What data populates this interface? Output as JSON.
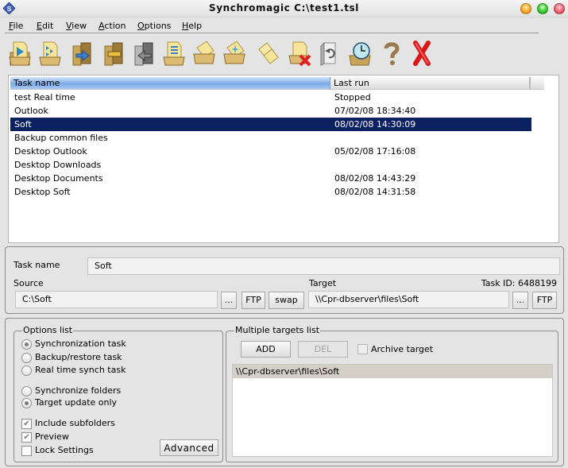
{
  "window": {
    "title": "Synchromagic C:\\test1.tsl",
    "app_icon": "synchromagic-logo-icon",
    "controls": [
      "minimize",
      "maximize",
      "close"
    ]
  },
  "menu": [
    {
      "label": "File",
      "accel": "F"
    },
    {
      "label": "Edit",
      "accel": "E"
    },
    {
      "label": "View",
      "accel": "V"
    },
    {
      "label": "Action",
      "accel": "A"
    },
    {
      "label": "Options",
      "accel": "O"
    },
    {
      "label": "Help",
      "accel": "H"
    }
  ],
  "toolbar": [
    {
      "icon": "folder-run-icon"
    },
    {
      "icon": "folder-run-all-icon"
    },
    {
      "icon": "folder-sync-icon"
    },
    {
      "icon": "folder-compare-icon"
    },
    {
      "icon": "folder-restore-icon"
    },
    {
      "icon": "folder-log-icon"
    },
    {
      "icon": "new-task-icon"
    },
    {
      "icon": "new-task-wizard-icon"
    },
    {
      "icon": "duplicate-task-icon"
    },
    {
      "icon": "delete-task-icon"
    },
    {
      "icon": "undo-icon"
    },
    {
      "icon": "schedule-icon"
    },
    {
      "icon": "help-icon"
    },
    {
      "icon": "exit-icon"
    }
  ],
  "tasks": {
    "columns": [
      "Task name",
      "Last run"
    ],
    "rows": [
      {
        "name": "test Real time",
        "last_run": "Stopped"
      },
      {
        "name": "Outlook",
        "last_run": "07/02/08 18:34:40"
      },
      {
        "name": "Soft",
        "last_run": "08/02/08 14:30:09",
        "selected": true
      },
      {
        "name": "Backup common files",
        "last_run": ""
      },
      {
        "name": "Desktop Outlook",
        "last_run": "05/02/08 17:16:08"
      },
      {
        "name": "Desktop Downloads",
        "last_run": ""
      },
      {
        "name": "Desktop Documents",
        "last_run": "08/02/08 14:43:29"
      },
      {
        "name": "Desktop Soft",
        "last_run": "08/02/08 14:31:58"
      }
    ]
  },
  "details": {
    "task_name_label": "Task name",
    "task_name_value": "Soft",
    "source_label": "Source",
    "source_value": "C:\\Soft",
    "target_label": "Target",
    "target_value": "\\\\Cpr-dbserver\\files\\Soft",
    "task_id": "Task ID: 6488199",
    "browse_label": "...",
    "ftp_label": "FTP",
    "swap_label": "swap"
  },
  "options": {
    "legend": "Options list",
    "task_types": [
      {
        "label": "Synchronization task",
        "checked": true
      },
      {
        "label": "Backup/restore task",
        "checked": false
      },
      {
        "label": "Real time synch task",
        "checked": false
      }
    ],
    "sync_modes": [
      {
        "label": "Synchronize folders",
        "checked": false
      },
      {
        "label": "Target update only",
        "checked": true
      }
    ],
    "checkboxes": [
      {
        "label": "Include subfolders",
        "checked": true
      },
      {
        "label": "Preview",
        "checked": true
      },
      {
        "label": "Lock Settings",
        "checked": false
      }
    ],
    "advanced_label": "Advanced"
  },
  "targets": {
    "legend": "Multiple targets list",
    "add_label": "ADD",
    "del_label": "DEL",
    "archive_label": "Archive target",
    "archive_checked": false,
    "items": [
      "\\\\Cpr-dbserver\\files\\Soft"
    ]
  }
}
